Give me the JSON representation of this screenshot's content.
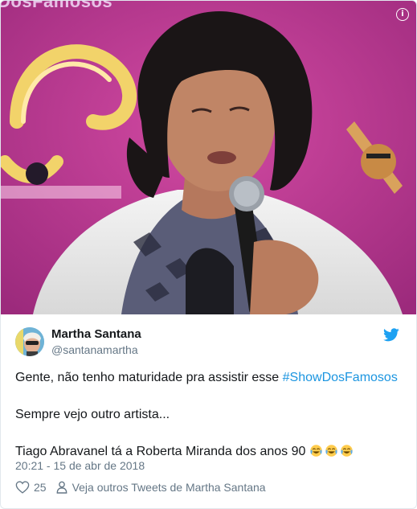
{
  "media": {
    "watermark": "DosFamosos",
    "info_icon": "info-icon"
  },
  "tweet": {
    "author_name": "Martha Santana",
    "author_handle": "@santanamartha",
    "brand_icon": "twitter-bird-icon",
    "text_line1_prefix": "Gente, não tenho maturidade pra assistir esse ",
    "hashtag": "#ShowDosFamosos",
    "text_line2": "Sempre vejo outro artista...",
    "text_line3": "Tiago Abravanel tá a Roberta Miranda dos anos 90",
    "emoji_count": 3,
    "emoji_name": "face-with-tears-of-joy",
    "timestamp": "20:21 - 15 de abr de 2018",
    "like_count": "25",
    "see_more": "Veja outros Tweets de Martha Santana"
  },
  "colors": {
    "link": "#1b95e0",
    "secondary_text": "#657786",
    "background_magenta": "#c2348f"
  }
}
